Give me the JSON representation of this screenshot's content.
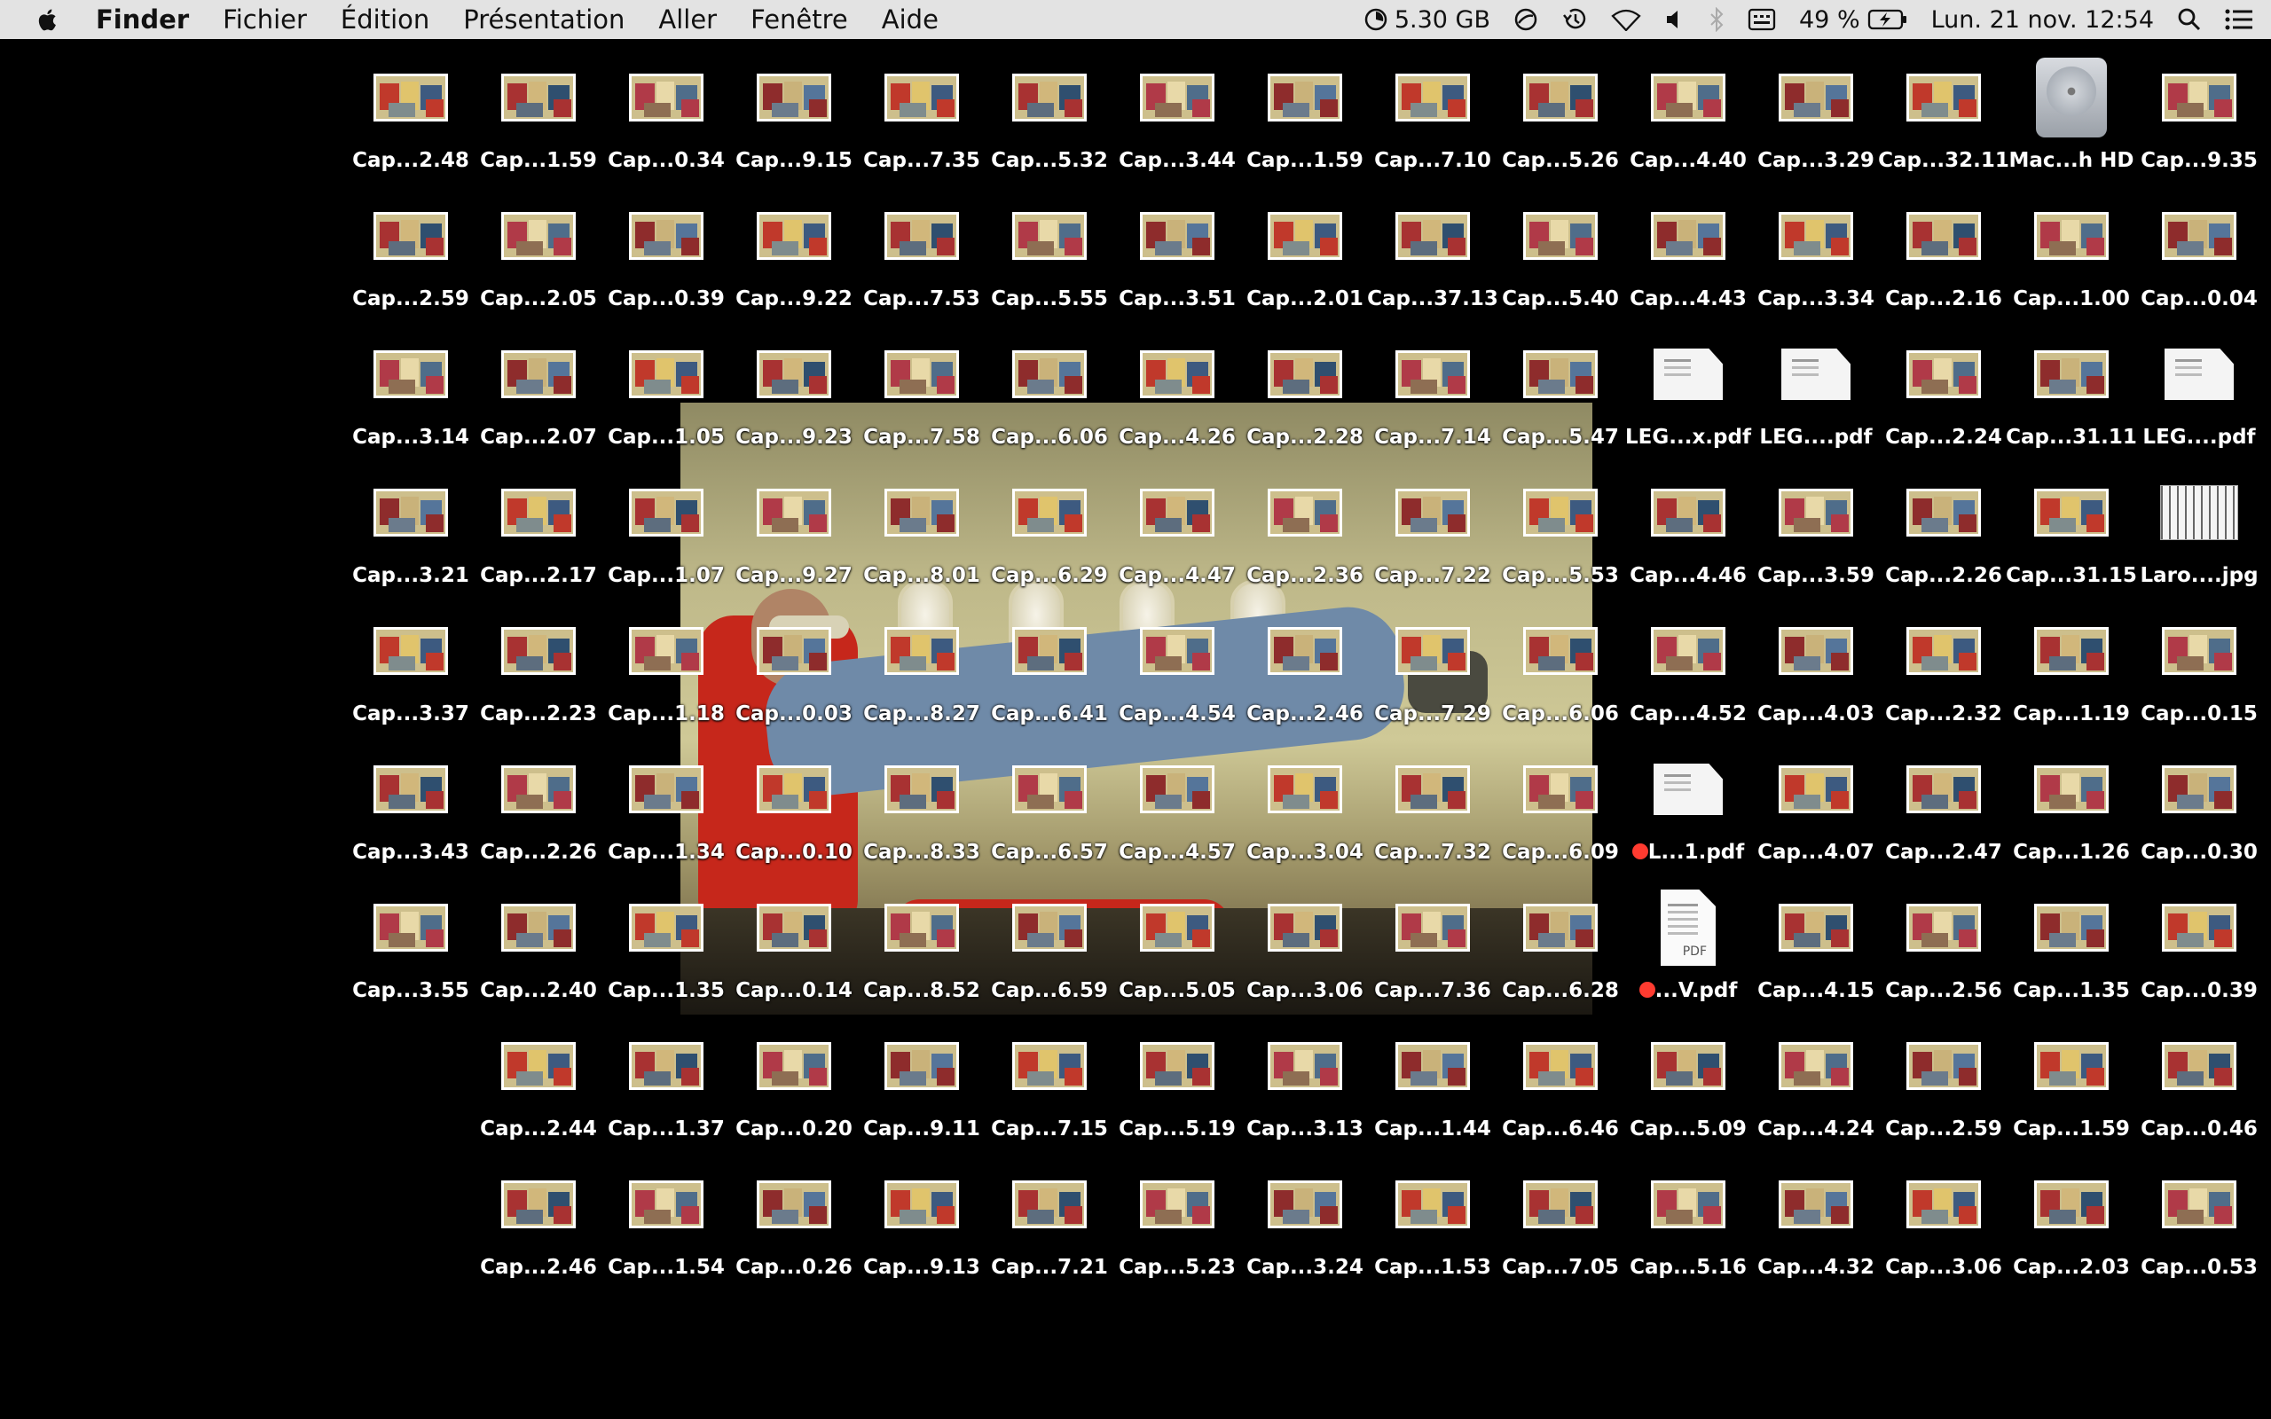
{
  "menubar": {
    "app": "Finder",
    "menus": [
      "Fichier",
      "Édition",
      "Présentation",
      "Aller",
      "Fenêtre",
      "Aide"
    ],
    "status": {
      "memory": "5.30 GB",
      "battery_pct": "49 %",
      "datetime": "Lun. 21 nov.  12:54"
    }
  },
  "desktop": {
    "columns": [
      [
        "Cap...2.48",
        "Cap...2.59",
        "Cap...3.14",
        "Cap...3.21",
        "Cap...3.37",
        "Cap...3.43",
        "Cap...3.55"
      ],
      [
        "Cap...1.59",
        "Cap...2.05",
        "Cap...2.07",
        "Cap...2.17",
        "Cap...2.23",
        "Cap...2.26",
        "Cap...2.40",
        "Cap...2.44",
        "Cap...2.46"
      ],
      [
        "Cap...0.34",
        "Cap...0.39",
        "Cap...1.05",
        "Cap...1.07",
        "Cap...1.18",
        "Cap...1.34",
        "Cap...1.35",
        "Cap...1.37",
        "Cap...1.54"
      ],
      [
        "Cap...9.15",
        "Cap...9.22",
        "Cap...9.23",
        "Cap...9.27",
        "Cap...0.03",
        "Cap...0.10",
        "Cap...0.14",
        "Cap...0.20",
        "Cap...0.26"
      ],
      [
        "Cap...7.35",
        "Cap...7.53",
        "Cap...7.58",
        "Cap...8.01",
        "Cap...8.27",
        "Cap...8.33",
        "Cap...8.52",
        "Cap...9.11",
        "Cap...9.13"
      ],
      [
        "Cap...5.32",
        "Cap...5.55",
        "Cap...6.06",
        "Cap...6.29",
        "Cap...6.41",
        "Cap...6.57",
        "Cap...6.59",
        "Cap...7.15",
        "Cap...7.21"
      ],
      [
        "Cap...3.44",
        "Cap...3.51",
        "Cap...4.26",
        "Cap...4.47",
        "Cap...4.54",
        "Cap...4.57",
        "Cap...5.05",
        "Cap...5.19",
        "Cap...5.23"
      ],
      [
        "Cap...1.59",
        "Cap...2.01",
        "Cap...2.28",
        "Cap...2.36",
        "Cap...2.46",
        "Cap...3.04",
        "Cap...3.06",
        "Cap...3.13",
        "Cap...3.24"
      ],
      [
        "Cap...7.10",
        "Cap...37.13",
        "Cap...7.14",
        "Cap...7.22",
        "Cap...7.29",
        "Cap...7.32",
        "Cap...7.36",
        "Cap...1.44",
        "Cap...1.53"
      ],
      [
        "Cap...5.26",
        "Cap...5.40",
        "Cap...5.47",
        "Cap...5.53",
        "Cap...6.06",
        "Cap...6.09",
        "Cap...6.28",
        "Cap...6.46",
        "Cap...7.05"
      ],
      [
        "Cap...4.40",
        "Cap...4.43",
        "LEG...x.pdf",
        "Cap...4.46",
        "Cap...4.52",
        "L...1.pdf",
        "...V.pdf",
        "Cap...5.09",
        "Cap...5.16"
      ],
      [
        "Cap...3.29",
        "Cap...3.34",
        "LEG....pdf",
        "Cap...3.59",
        "Cap...4.03",
        "Cap...4.07",
        "Cap...4.15",
        "Cap...4.24",
        "Cap...4.32"
      ],
      [
        "Cap...32.11",
        "Cap...2.16",
        "Cap...2.24",
        "Cap...2.26",
        "Cap...2.32",
        "Cap...2.47",
        "Cap...2.56",
        "Cap...2.59",
        "Cap...3.06"
      ],
      [
        "Mac...h HD",
        "Cap...1.00",
        "Cap...31.11",
        "Cap...31.15",
        "Cap...1.19",
        "Cap...1.26",
        "Cap...1.35",
        "Cap...1.59",
        "Cap...2.03"
      ],
      [
        "Cap...9.35",
        "Cap...0.04",
        "LEG....pdf",
        "Laro....jpg",
        "Cap...0.15",
        "Cap...0.30",
        "Cap...0.39",
        "Cap...0.46",
        "Cap...0.53"
      ]
    ],
    "special": {
      "10-2": "pdf",
      "11-2": "pdf",
      "14-2": "pdf",
      "10-5": "pdf-tag",
      "10-6": "pdfdoc-tag",
      "13-0": "hd",
      "14-3": "jpg"
    },
    "pdf_badge": "PDF"
  }
}
